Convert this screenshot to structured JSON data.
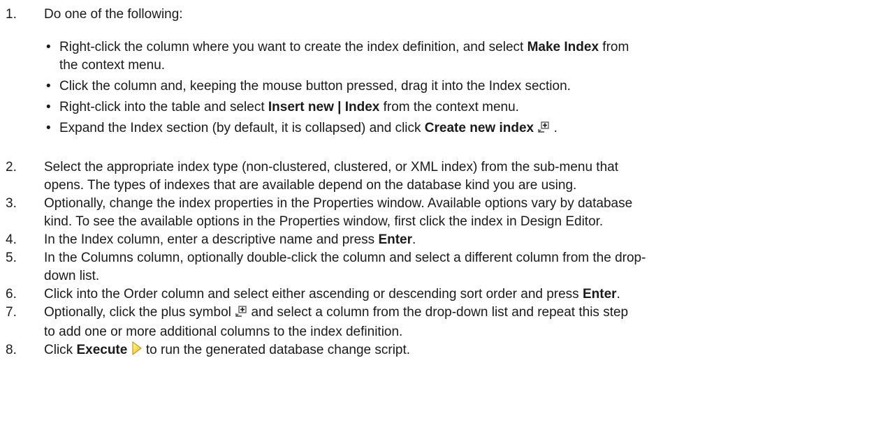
{
  "step1": {
    "num": "1.",
    "text": "Do one of the following:",
    "bullets": [
      {
        "pre": "Right-click the column where you want to create the index definition, and select ",
        "bold": "Make Index",
        "post": " from",
        "line2": "the context menu."
      },
      {
        "text": "Click the column and, keeping the mouse button pressed, drag it into the Index section."
      },
      {
        "pre": "Right-click into the table and select ",
        "bold": "Insert new | Index",
        "post": " from the context menu."
      },
      {
        "pre": "Expand the Index section (by default, it is collapsed) and click ",
        "bold": "Create new index",
        "icon": "add-row-icon",
        "post": "."
      }
    ]
  },
  "steps": [
    {
      "num": "2.",
      "line1": "Select the appropriate index type (non-clustered, clustered, or XML index) from the sub-menu that",
      "line2": "opens. The types of indexes that are available depend on the database kind you are using."
    },
    {
      "num": "3.",
      "line1": "Optionally, change the index properties in the Properties window. Available options vary by database",
      "line2": "kind. To see the available options in the Properties window, first click the index in Design Editor."
    },
    {
      "num": "4.",
      "pre": "In the Index column, enter a descriptive name and press ",
      "bold": "Enter",
      "post": "."
    },
    {
      "num": "5.",
      "line1": "In the Columns column, optionally double-click the column and select a different column from the drop-",
      "line2": "down list."
    },
    {
      "num": "6.",
      "pre": "Click into the Order column and select either ascending or descending sort order and press ",
      "bold": "Enter",
      "post": "."
    },
    {
      "num": "7.",
      "pre": "Optionally, click the plus symbol",
      "icon": "add-row-icon",
      "post": "and select a column from the drop-down list and repeat this step",
      "line2": "to add one or more additional columns to the index definition."
    },
    {
      "num": "8.",
      "pre": "Click ",
      "bold": "Execute",
      "icon": "execute-arrow-icon",
      "post": " to run the generated database change script."
    }
  ],
  "colors": {
    "text": "#1a1a1a",
    "execute_icon": "#f2c400"
  }
}
